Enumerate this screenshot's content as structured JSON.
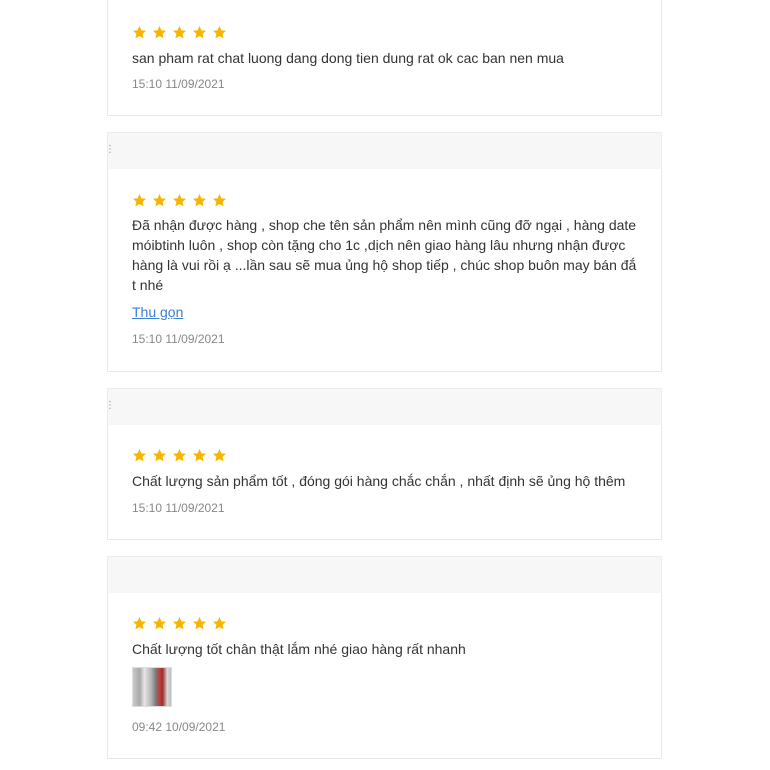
{
  "colors": {
    "star": "#f7b500",
    "link": "#3b7fd4",
    "text": "#333333",
    "muted": "#888888"
  },
  "reviews": [
    {
      "rating": 5,
      "text": "san pham rat chat luong dang dong tien dung rat ok cac ban nen mua",
      "time": "15:10 11/09/2021"
    },
    {
      "rating": 5,
      "text_lines": [
        "Đã nhận được hàng , shop che tên sản phẩm nên mình cũng đỡ ngại , hàng date",
        "móibtinh luôn , shop còn tặng cho 1c ,dịch nên giao hàng lâu nhưng nhận được",
        "hàng là vui rồi ạ ...lần sau sẽ mua ủng hộ shop tiếp , chúc shop buôn may bán đắ",
        "t nhé"
      ],
      "collapse_label": "Thu gọn",
      "time": "15:10 11/09/2021"
    },
    {
      "rating": 5,
      "text": "Chất lượng sản phẩm tốt , đóng gói hàng chắc chắn , nhất định sẽ ủng hộ thêm",
      "time": "15:10 11/09/2021"
    },
    {
      "rating": 5,
      "text": "Chất lượng tốt chân thật lắm nhé giao hàng rất nhanh",
      "image_icon": "product-photo-thumbnail",
      "time": "09:42 10/09/2021"
    }
  ]
}
